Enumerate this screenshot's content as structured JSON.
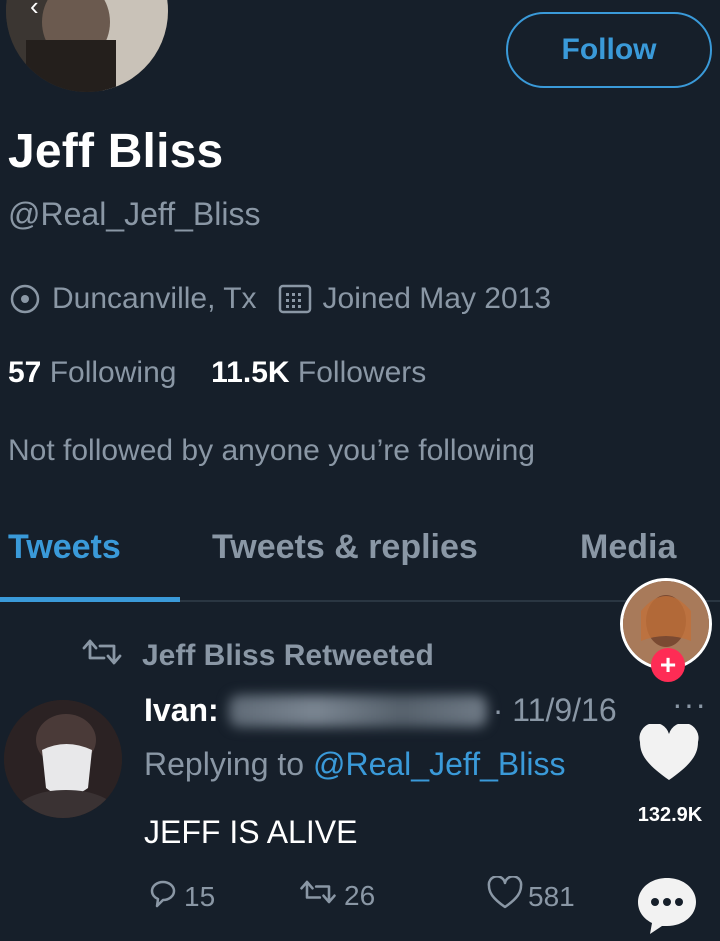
{
  "profile": {
    "follow_label": "Follow",
    "name": "Jeff Bliss",
    "handle": "@Real_Jeff_Bliss",
    "location": "Duncanville, Tx",
    "joined": "Joined May 2013",
    "following_count": "57",
    "following_label": "Following",
    "followers_count": "11.5K",
    "followers_label": "Followers",
    "not_followed_text": "Not followed by anyone you’re following"
  },
  "tabs": [
    {
      "label": "Tweets",
      "active": true
    },
    {
      "label": "Tweets & replies",
      "active": false
    },
    {
      "label": "Media",
      "active": false
    }
  ],
  "tweet": {
    "retweeted_by": "Jeff Bliss Retweeted",
    "author_prefix": "Ivan:",
    "date": "· 11/9/16",
    "more": "···",
    "replying_prefix": "Replying to ",
    "replying_mention": "@Real_Jeff_Bliss",
    "text": "JEFF IS ALIVE",
    "replies": "15",
    "retweets": "26",
    "likes": "581"
  },
  "overlay": {
    "follow_plus": "+",
    "like_count": "132.9K"
  },
  "icons": {
    "back": "back-arrow-icon",
    "location": "location-pin-icon",
    "calendar": "calendar-icon",
    "retweet": "retweet-icon",
    "reply": "reply-icon",
    "like": "heart-icon",
    "comment": "comment-bubble-icon"
  },
  "colors": {
    "background": "#161f2a",
    "accent": "#3a9ad9",
    "muted": "#8a97a5",
    "tiktok_red": "#fe2c55"
  }
}
